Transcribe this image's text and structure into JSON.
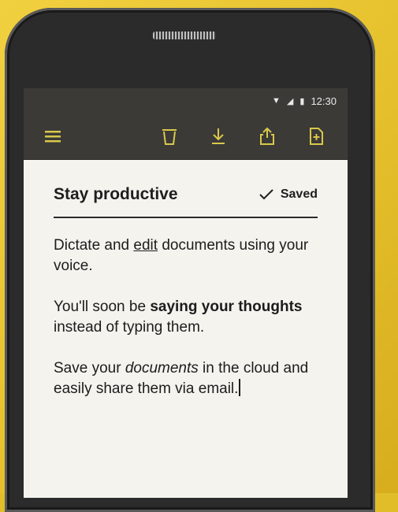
{
  "status_bar": {
    "time": "12:30"
  },
  "toolbar": {
    "menu_icon": "hamburger-icon",
    "delete_icon": "trash-icon",
    "download_icon": "download-icon",
    "share_icon": "share-icon",
    "new_doc_icon": "new-document-icon"
  },
  "document": {
    "title": "Stay productive",
    "saved_label": "Saved",
    "p1_a": "Dictate and ",
    "p1_link": "edit",
    "p1_b": " documents using your voice.",
    "p2_a": "You'll soon be ",
    "p2_bold": "saying your thoughts",
    "p2_b": " instead of typing them.",
    "p3_a": "Save your ",
    "p3_italic": "documents",
    "p3_b": " in the cloud and easily share them via email."
  },
  "colors": {
    "background": "#e2bd2a",
    "toolbar": "#3b3a37",
    "toolbar_icon": "#d8c84a",
    "page": "#f4f3ee"
  }
}
